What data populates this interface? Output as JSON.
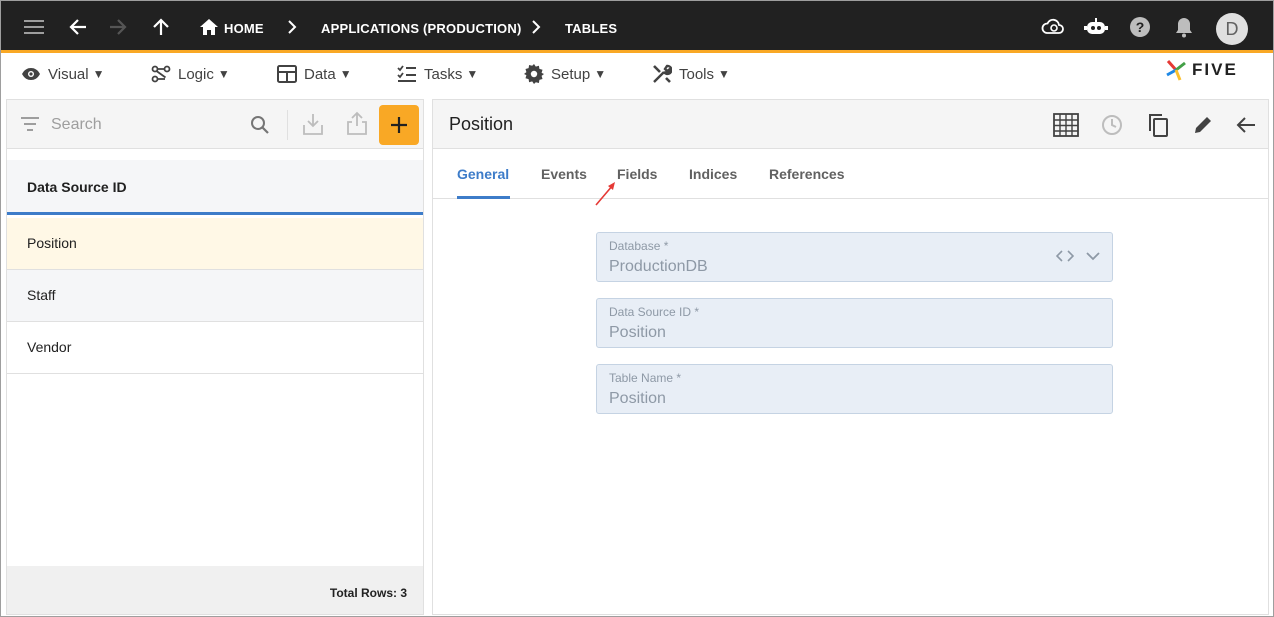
{
  "appbar": {
    "home_label": "HOME",
    "crumb1": "APPLICATIONS (PRODUCTION)",
    "crumb2": "TABLES",
    "avatar_letter": "D",
    "bar_color": "#212121",
    "accent_color": "#f9a825"
  },
  "menu": {
    "visual": "Visual",
    "logic": "Logic",
    "data": "Data",
    "tasks": "Tasks",
    "setup": "Setup",
    "tools": "Tools",
    "caret": "▼"
  },
  "logo": {
    "text": "FIVE"
  },
  "left": {
    "search_placeholder": "Search",
    "add_symbol": "+",
    "column_header": "Data Source ID",
    "rows": [
      "Position",
      "Staff",
      "Vendor"
    ],
    "footer": "Total Rows: 3"
  },
  "right": {
    "title": "Position",
    "tabs": [
      "General",
      "Events",
      "Fields",
      "Indices",
      "References"
    ],
    "fields": [
      {
        "label": "Database *",
        "value": "ProductionDB"
      },
      {
        "label": "Data Source ID *",
        "value": "Position"
      },
      {
        "label": "Table Name *",
        "value": "Position"
      }
    ]
  },
  "colors": {
    "active_tab": "#3d7cc9",
    "selected_row": "#fff8e6",
    "field_bg": "#e8eef6",
    "annotation_arrow": "#e53935"
  }
}
